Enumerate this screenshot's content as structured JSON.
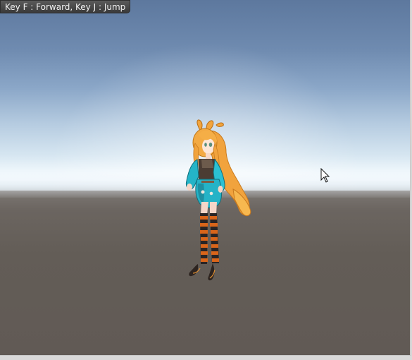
{
  "hud": {
    "controls_text": "Key F : Forward, Key J : Jump"
  },
  "scene": {
    "sky_top_color": "#5d789e",
    "horizon_color": "#f6fbff",
    "ground_color": "#635d57"
  },
  "character": {
    "hair_color": "#f0a23a",
    "outfit_color": "#2bb8c9",
    "stocking_colors": [
      "#d9651a",
      "#2a2424"
    ]
  },
  "cursor": {
    "icon": "arrow-cursor-icon"
  }
}
